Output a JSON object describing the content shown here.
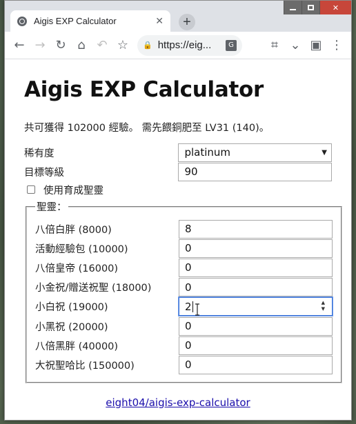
{
  "browser": {
    "tab_title": "Aigis EXP Calculator",
    "url": "https://eig...",
    "new_tab_symbol": "+",
    "close_tab_symbol": "✕"
  },
  "page": {
    "heading": "Aigis EXP Calculator",
    "summary": "共可獲得 102000 經驗。 需先餵銅肥至 LV31 (140)。",
    "rarity": {
      "label": "稀有度",
      "value": "platinum"
    },
    "target_level": {
      "label": "目標等級",
      "value": "90"
    },
    "use_nurture": {
      "label": "使用育成聖靈",
      "checked": false
    },
    "spirits": {
      "legend": "聖靈：",
      "items": [
        {
          "label": "八倍白胖 (8000)",
          "value": "8"
        },
        {
          "label": "活動經驗包 (10000)",
          "value": "0"
        },
        {
          "label": "八倍皇帝 (16000)",
          "value": "0"
        },
        {
          "label": "小金祝/贈送祝聖 (18000)",
          "value": "0"
        },
        {
          "label": "小白祝 (19000)",
          "value": "2"
        },
        {
          "label": "小黑祝 (20000)",
          "value": "0"
        },
        {
          "label": "八倍黑胖 (40000)",
          "value": "0"
        },
        {
          "label": "大祝聖哈比 (150000)",
          "value": "0"
        }
      ]
    },
    "footer_link": "eight04/aigis-exp-calculator"
  },
  "colors": {
    "link": "#1a0dab",
    "focus": "#3b73d8",
    "tabstrip": "#dee1e6"
  }
}
